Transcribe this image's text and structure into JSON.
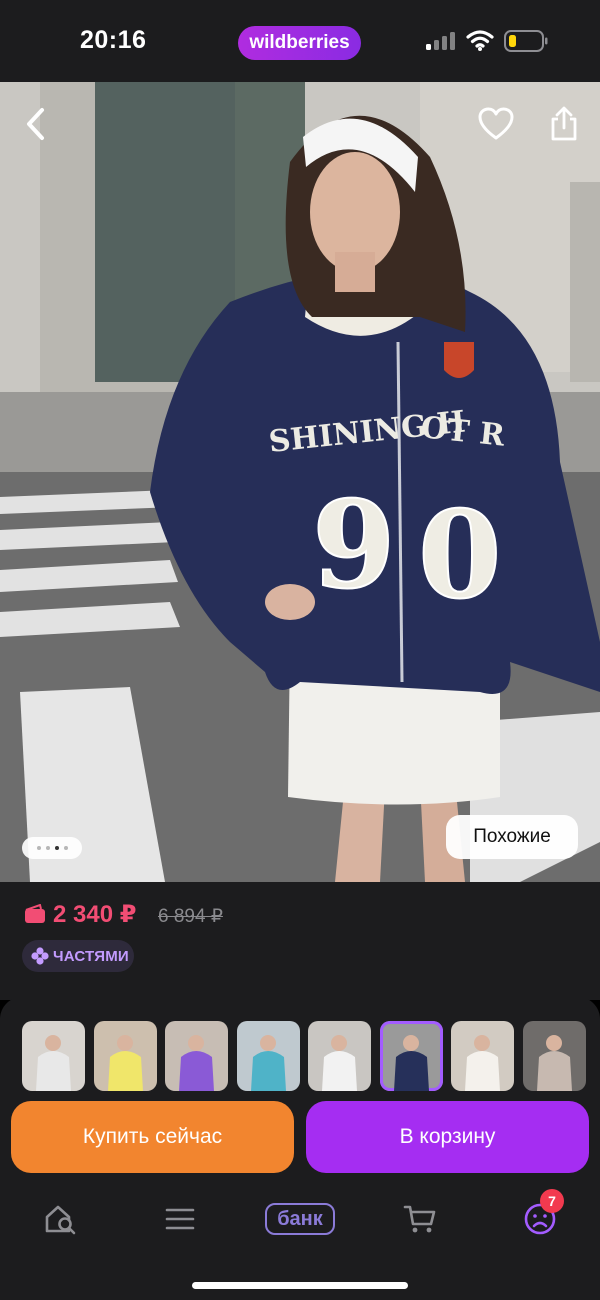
{
  "status_bar": {
    "time": "20:16",
    "brand": "wildberries",
    "icons": [
      "signal-icon",
      "wifi-icon",
      "battery-low-icon"
    ]
  },
  "hero": {
    "description": "Product photo: woman in navy zip hoodie with '90' print and white skirt",
    "hoodie_print": "SHINING H  OT R  D",
    "hoodie_number": "90",
    "icons": [
      "back-chevron-icon",
      "heart-icon",
      "share-icon"
    ],
    "similar_label": "Похожие",
    "pager": {
      "count": 4,
      "active": 3
    }
  },
  "price": {
    "current": "2 340 ₽",
    "old": "6 894 ₽",
    "parts_label": "ЧАСТЯМИ"
  },
  "thumbnails": [
    {
      "name": "thumb-1",
      "bg": "#d8d4cf",
      "accent": "#e8e8e8",
      "selected": false
    },
    {
      "name": "thumb-2",
      "bg": "#cdbfae",
      "accent": "#f0e66a",
      "selected": false
    },
    {
      "name": "thumb-3",
      "bg": "#c7bdb4",
      "accent": "#8a5ad6",
      "selected": false
    },
    {
      "name": "thumb-4",
      "bg": "#bfc9cf",
      "accent": "#4fb3c8",
      "selected": false
    },
    {
      "name": "thumb-5",
      "bg": "#c9c6c2",
      "accent": "#f2f2f2",
      "selected": false
    },
    {
      "name": "thumb-6",
      "bg": "#9a9a9a",
      "accent": "#26305a",
      "selected": true
    },
    {
      "name": "thumb-7",
      "bg": "#d2cbc2",
      "accent": "#f4f1ec",
      "selected": false
    },
    {
      "name": "thumb-8",
      "bg": "#6f6c6a",
      "accent": "#c7b9b0",
      "selected": false
    }
  ],
  "actions": {
    "buy_now": "Купить сейчас",
    "add_to_cart": "В корзину"
  },
  "tabbar": {
    "items": [
      "home-search-icon",
      "catalog-menu-icon",
      "bank-tab",
      "cart-icon",
      "profile-icon"
    ],
    "bank_label": "банк",
    "profile_badge": "7"
  },
  "colors": {
    "background": "#1c1c1e",
    "price": "#f24d74",
    "buy_button": "#f2852f",
    "cart_button": "#a52df2",
    "bank_accent": "#8b7bd8"
  }
}
